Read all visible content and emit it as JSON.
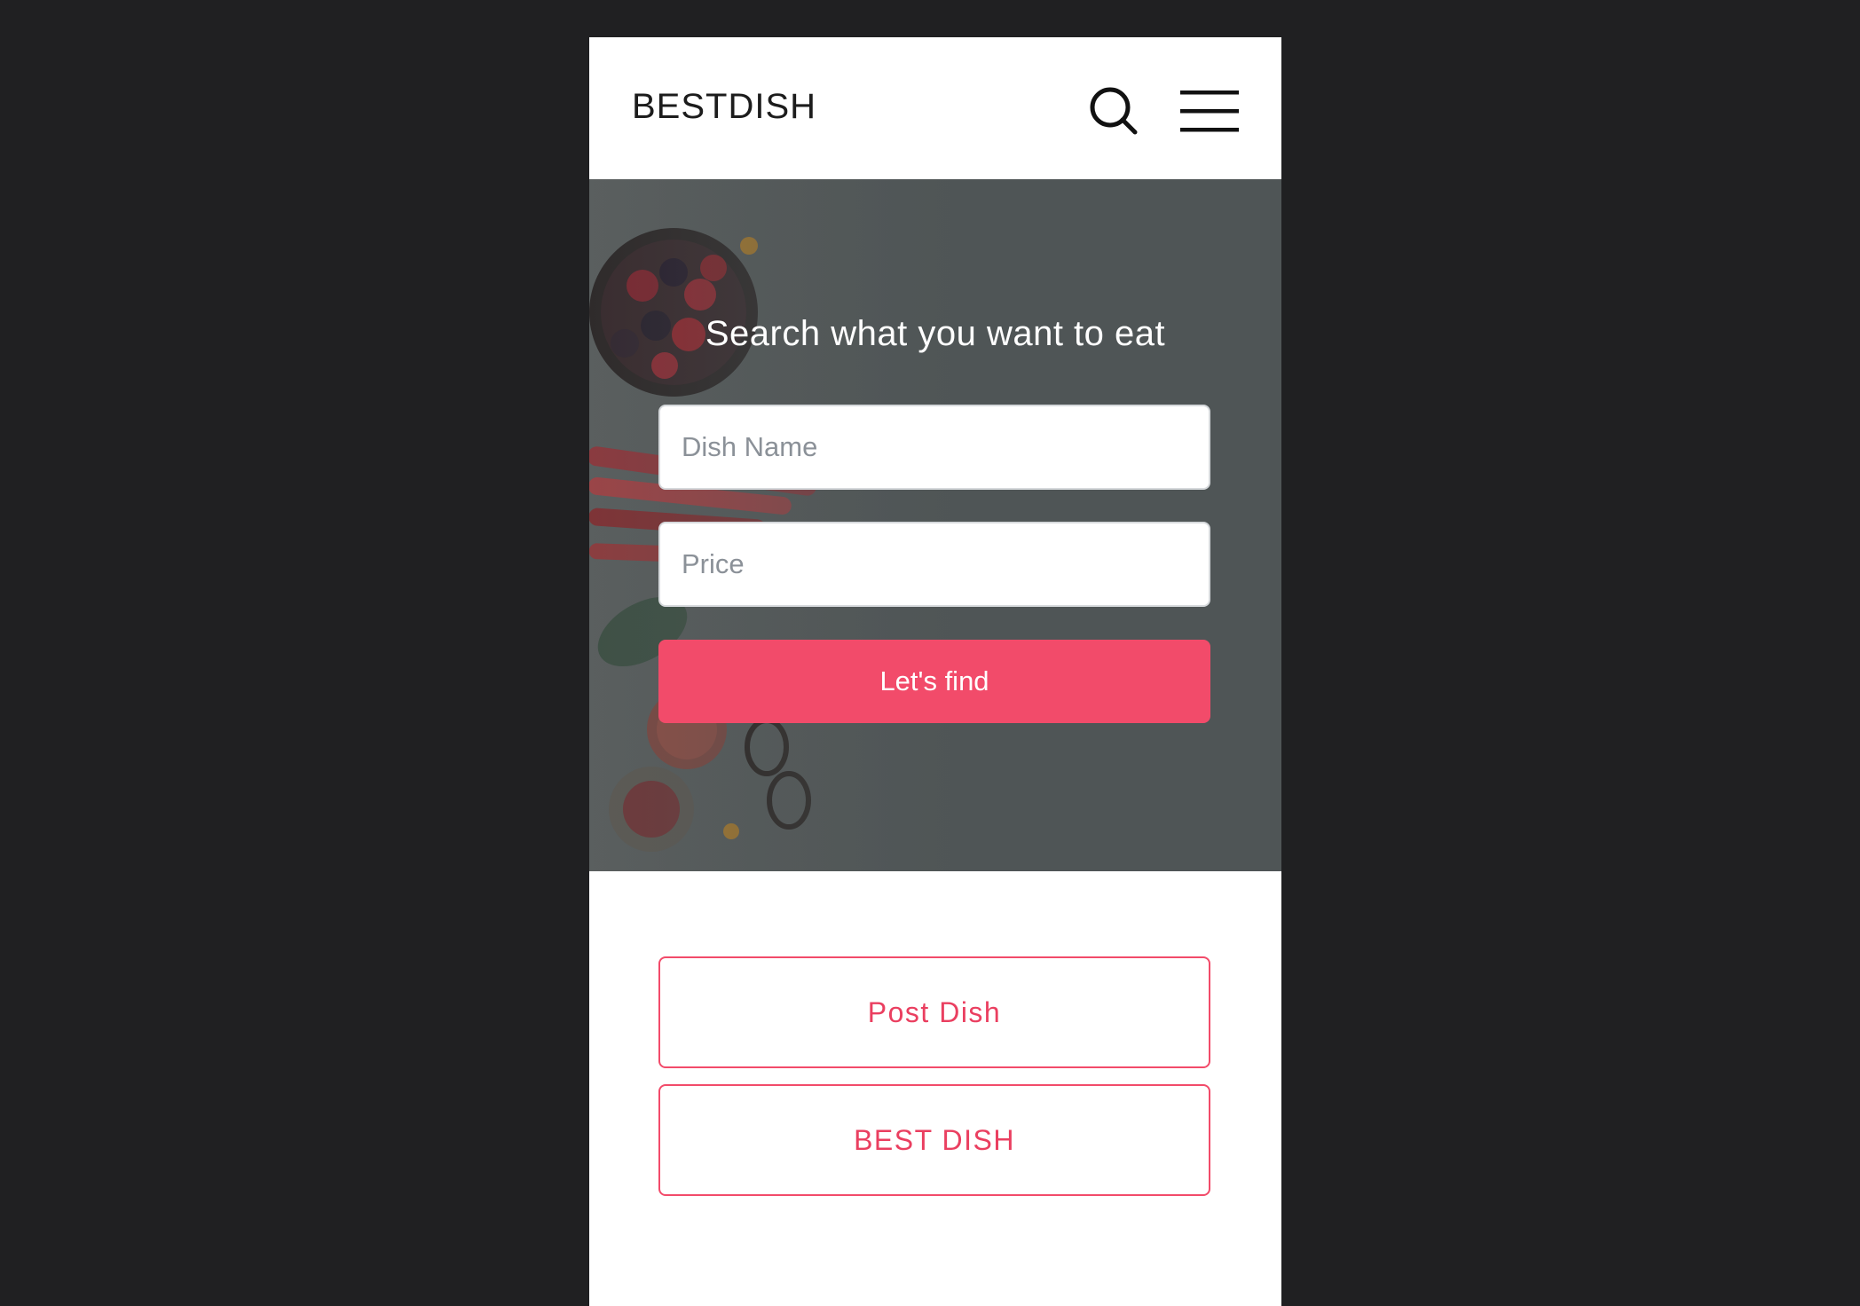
{
  "navbar": {
    "brand": "BESTDISH",
    "search_icon": "search-icon",
    "menu_icon": "hamburger-menu-icon"
  },
  "hero": {
    "title": "Search what you want to eat",
    "dish_placeholder": "Dish Name",
    "price_placeholder": "Price",
    "find_label": "Let's find"
  },
  "actions": {
    "post_label": "Post Dish",
    "best_label": "BEST DISH"
  },
  "colors": {
    "page_background": "#202022",
    "accent": "#f24b6a",
    "hero_overlay": "#4f5556"
  }
}
